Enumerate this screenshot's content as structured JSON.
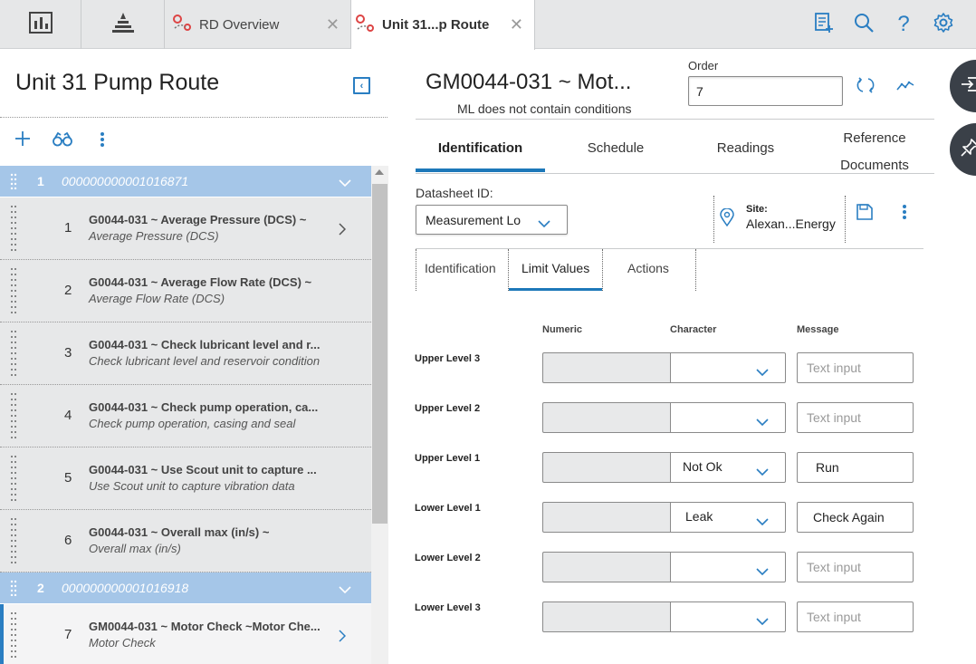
{
  "tabs": [
    {
      "label": "RD Overview"
    },
    {
      "label": "Unit 31...p Route"
    }
  ],
  "left": {
    "title": "Unit 31 Pump Route",
    "groups": [
      {
        "num": "1",
        "id": "000000000001016871"
      },
      {
        "num": "2",
        "id": "000000000001016918"
      }
    ],
    "items": [
      {
        "num": "1",
        "title": "G0044-031 ~ Average Pressure (DCS) ~",
        "subtitle": "Average Pressure (DCS)"
      },
      {
        "num": "2",
        "title": "G0044-031 ~ Average Flow Rate (DCS) ~",
        "subtitle": "Average Flow Rate (DCS)"
      },
      {
        "num": "3",
        "title": "G0044-031 ~ Check lubricant level and r...",
        "subtitle": "Check lubricant level and reservoir condition"
      },
      {
        "num": "4",
        "title": "G0044-031 ~ Check pump operation, ca...",
        "subtitle": "Check pump operation, casing and seal"
      },
      {
        "num": "5",
        "title": "G0044-031 ~ Use Scout unit to capture ...",
        "subtitle": "Use Scout unit to capture vibration data"
      },
      {
        "num": "6",
        "title": "G0044-031 ~ Overall max (in/s) ~",
        "subtitle": "Overall max (in/s)"
      },
      {
        "num": "7",
        "title": "GM0044-031 ~ Motor Check ~Motor Che...",
        "subtitle": "Motor Check"
      }
    ]
  },
  "record": {
    "title": "GM0044-031 ~ Mot...",
    "subtitle": "ML does not contain conditions",
    "order_label": "Order",
    "order_value": "7",
    "tabs": {
      "identification": "Identification",
      "schedule": "Schedule",
      "readings": "Readings",
      "reference_1": "Reference",
      "reference_2": "Documents"
    },
    "datasheet_label": "Datasheet ID:",
    "datasheet_value": "Measurement Lo",
    "site_label": "Site:",
    "site_value": "Alexan...Energy",
    "subtabs": {
      "identification": "Identification",
      "limit_values": "Limit Values",
      "actions": "Actions"
    },
    "columns": {
      "numeric": "Numeric",
      "character": "Character",
      "message": "Message"
    },
    "levels": [
      {
        "label": "Upper Level 3",
        "character": "",
        "message": "",
        "placeholder": "Text input"
      },
      {
        "label": "Upper Level 2",
        "character": "",
        "message": "",
        "placeholder": "Text input"
      },
      {
        "label": "Upper Level 1",
        "character": "Not Ok",
        "message": "Run",
        "placeholder": ""
      },
      {
        "label": "Lower Level 1",
        "character": "Leak",
        "message": "Check Again",
        "placeholder": ""
      },
      {
        "label": "Lower Level 2",
        "character": "",
        "message": "",
        "placeholder": "Text input"
      },
      {
        "label": "Lower Level 3",
        "character": "",
        "message": "",
        "placeholder": "Text input"
      }
    ]
  },
  "colors": {
    "accent": "#1d78b9",
    "group_row": "#a5c6e8",
    "item_row": "#e7e8e9"
  }
}
